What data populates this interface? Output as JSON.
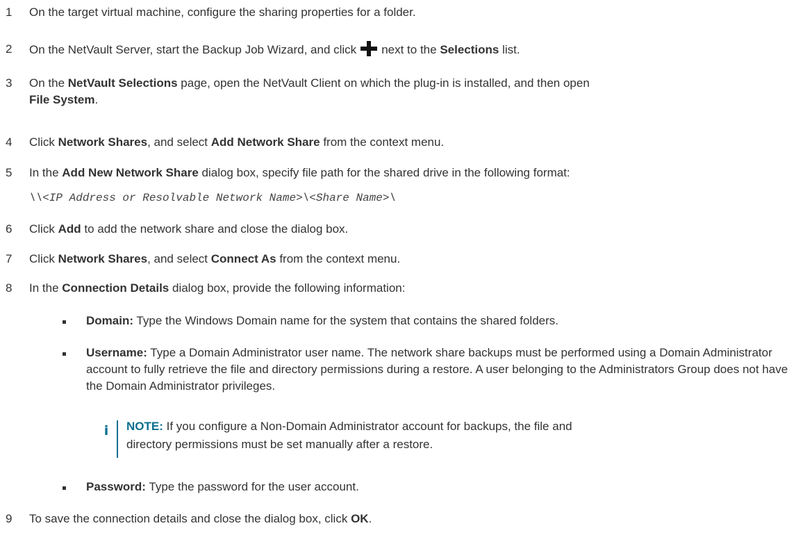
{
  "steps": [
    {
      "num": "1",
      "t1": "On the target virtual machine, configure the sharing properties for a folder."
    },
    {
      "num": "2",
      "t1": "On the NetVault Server, start the Backup Job Wizard, and click",
      "t2": "next to the",
      "b1": "Selections",
      "t3": "list."
    },
    {
      "num": "3",
      "t1": "On the",
      "b1": "NetVault Selections",
      "t2": "page, open the NetVault Client on which the plug-in is installed, and then open",
      "b2": "File System",
      "t3": "."
    },
    {
      "num": "4",
      "t1": "Click",
      "b1": "Network Shares",
      "t2": ", and select",
      "b2": "Add Network Share",
      "t3": "from the context menu."
    },
    {
      "num": "5",
      "t1": "In the",
      "b1": "Add New Network Share",
      "t2": "dialog box, specify file path for the shared drive in the following format:"
    },
    {
      "num": "6",
      "t1": "Click",
      "b1": "Add",
      "t2": "to add the network share and close the dialog box."
    },
    {
      "num": "7",
      "t1": "Click",
      "b1": "Network Shares",
      "t2": ", and select",
      "b2": "Connect As",
      "t3": "from the context menu."
    },
    {
      "num": "8",
      "t1": "In the",
      "b1": "Connection Details",
      "t2": "dialog box, provide the following information:"
    },
    {
      "num": "9",
      "t1": "To save the connection details and close the dialog box, click",
      "b1": "OK",
      "t2": "."
    }
  ],
  "path_format": "\\\\<IP Address or Resolvable Network Name>\\<Share Name>\\",
  "bullets": [
    {
      "label": "Domain:",
      "text": "Type the Windows Domain name for the system that contains the shared folders."
    },
    {
      "label": "Username:",
      "text": "Type a Domain Administrator user name. The network share backups must be performed using a Domain Administrator account to fully retrieve the file and directory permissions during a restore. A user belonging to the Administrators Group does not have the Domain Administrator privileges."
    },
    {
      "label": "Password:",
      "text": "Type the password for the user account."
    }
  ],
  "note": {
    "label": "NOTE:",
    "text": "If you configure a Non-Domain Administrator account for backups, the file and directory permissions must be set manually after a restore.",
    "icon": "info-icon"
  },
  "colors": {
    "text": "#333333",
    "accent": "#0a6f8f"
  },
  "icons": {
    "add": "plus-icon"
  }
}
